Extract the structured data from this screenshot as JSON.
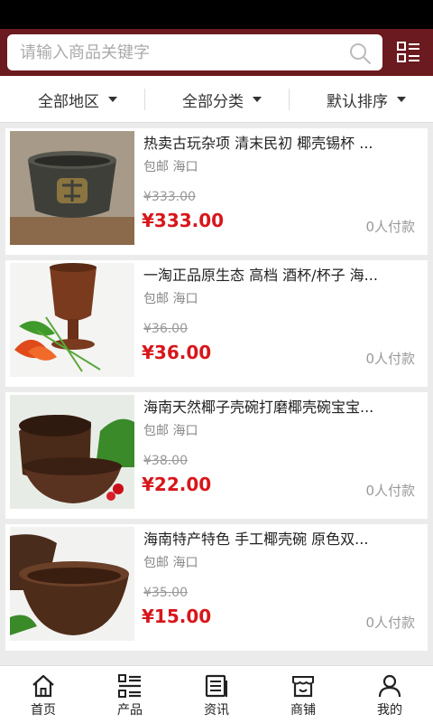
{
  "search": {
    "placeholder": "请输入商品关键字"
  },
  "filters": [
    {
      "label": "全部地区"
    },
    {
      "label": "全部分类"
    },
    {
      "label": "默认排序"
    }
  ],
  "products": [
    {
      "title": "热卖古玩杂项 清末民初 椰壳锡杯 ...",
      "tags": "包邮 海口",
      "old_price": "¥333.00",
      "price": "¥333.00",
      "paid": "0人付款"
    },
    {
      "title": "一淘正品原生态 高档 酒杯/杯子 海...",
      "tags": "包邮 海口",
      "old_price": "¥36.00",
      "price": "¥36.00",
      "paid": "0人付款"
    },
    {
      "title": "海南天然椰子壳碗打磨椰壳碗宝宝...",
      "tags": "包邮 海口",
      "old_price": "¥38.00",
      "price": "¥22.00",
      "paid": "0人付款"
    },
    {
      "title": "海南特产特色 手工椰壳碗 原色双...",
      "tags": "包邮 海口",
      "old_price": "¥35.00",
      "price": "¥15.00",
      "paid": "0人付款"
    }
  ],
  "tabs": [
    {
      "label": "首页",
      "icon": "home-icon"
    },
    {
      "label": "产品",
      "icon": "list-icon"
    },
    {
      "label": "资讯",
      "icon": "news-icon"
    },
    {
      "label": "商铺",
      "icon": "shop-icon"
    },
    {
      "label": "我的",
      "icon": "user-icon"
    }
  ],
  "colors": {
    "header": "#6b1a1f",
    "price": "#d8161b"
  }
}
